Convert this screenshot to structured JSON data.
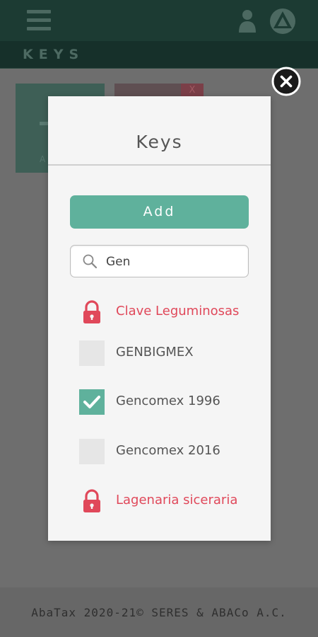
{
  "app": {
    "section_title": "KEYS",
    "footer": "AbaTax 2020-21© SERES & ABACo A.C.",
    "tile_label": "A",
    "tile_badge": "X"
  },
  "modal": {
    "title": "Keys",
    "add_label": "Add",
    "search": {
      "value": "Gen"
    },
    "items": [
      {
        "label": "Clave Leguminosas",
        "state": "locked"
      },
      {
        "label": "GENBIGMEX",
        "state": "unchecked"
      },
      {
        "label": "Gencomex 1996",
        "state": "checked"
      },
      {
        "label": "Gencomex 2016",
        "state": "unchecked"
      },
      {
        "label": "Lagenaria siceraria",
        "state": "locked"
      }
    ]
  },
  "colors": {
    "accent": "#5fb19c",
    "locked": "#e0485a",
    "topbar": "#1c3b33"
  },
  "icons": [
    "menu-icon",
    "user-icon",
    "app-logo-icon",
    "close-icon",
    "search-icon",
    "lock-icon",
    "checkmark-icon"
  ]
}
